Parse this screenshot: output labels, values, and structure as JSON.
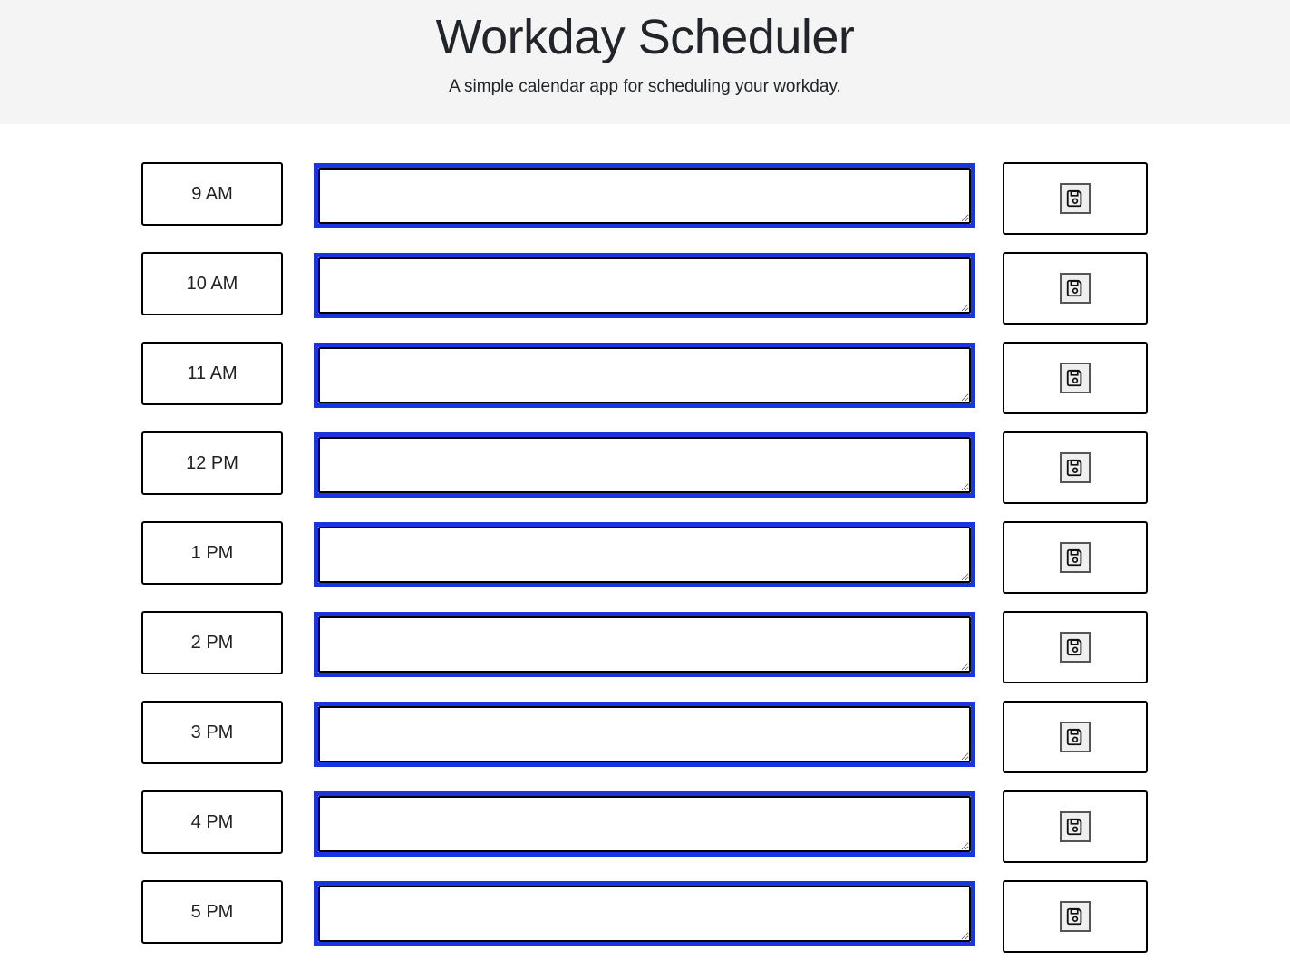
{
  "header": {
    "title": "Workday Scheduler",
    "lead": "A simple calendar app for scheduling your workday."
  },
  "accent_color": "#1a34e0",
  "time_blocks": [
    {
      "hour_label": "9 AM",
      "task_text": "",
      "save_icon": "floppy-disk-icon"
    },
    {
      "hour_label": "10 AM",
      "task_text": "",
      "save_icon": "floppy-disk-icon"
    },
    {
      "hour_label": "11 AM",
      "task_text": "",
      "save_icon": "floppy-disk-icon"
    },
    {
      "hour_label": "12 PM",
      "task_text": "",
      "save_icon": "floppy-disk-icon"
    },
    {
      "hour_label": "1 PM",
      "task_text": "",
      "save_icon": "floppy-disk-icon"
    },
    {
      "hour_label": "2 PM",
      "task_text": "",
      "save_icon": "floppy-disk-icon"
    },
    {
      "hour_label": "3 PM",
      "task_text": "",
      "save_icon": "floppy-disk-icon"
    },
    {
      "hour_label": "4 PM",
      "task_text": "",
      "save_icon": "floppy-disk-icon"
    },
    {
      "hour_label": "5 PM",
      "task_text": "",
      "save_icon": "floppy-disk-icon"
    }
  ]
}
